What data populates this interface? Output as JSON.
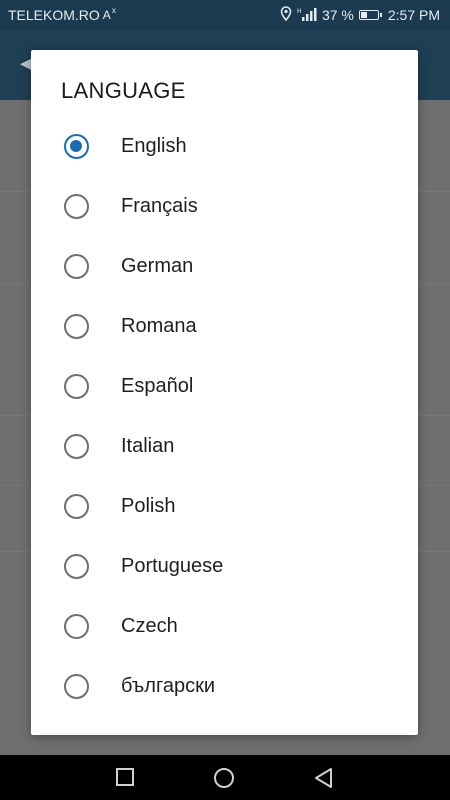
{
  "status": {
    "carrier": "TELEKOM.RO",
    "carrier_extra": "A",
    "battery_percent": "37 %",
    "battery_level": 0.37,
    "time": "2:57 PM"
  },
  "dialog": {
    "title": "LANGUAGE",
    "selected_index": 0,
    "options": [
      {
        "label": "English"
      },
      {
        "label": "Français"
      },
      {
        "label": "German"
      },
      {
        "label": "Romana"
      },
      {
        "label": "Español"
      },
      {
        "label": "Italian"
      },
      {
        "label": "Polish"
      },
      {
        "label": "Portuguese"
      },
      {
        "label": "Czech"
      },
      {
        "label": "български"
      }
    ]
  },
  "colors": {
    "accent": "#1b6bb0",
    "status_bar": "#1b3a4f",
    "app_bar": "#1f3f55"
  },
  "icons": {
    "status": [
      "location-icon",
      "signal-icon",
      "battery-icon"
    ],
    "nav": [
      "recent-apps-icon",
      "home-icon",
      "back-icon"
    ]
  }
}
